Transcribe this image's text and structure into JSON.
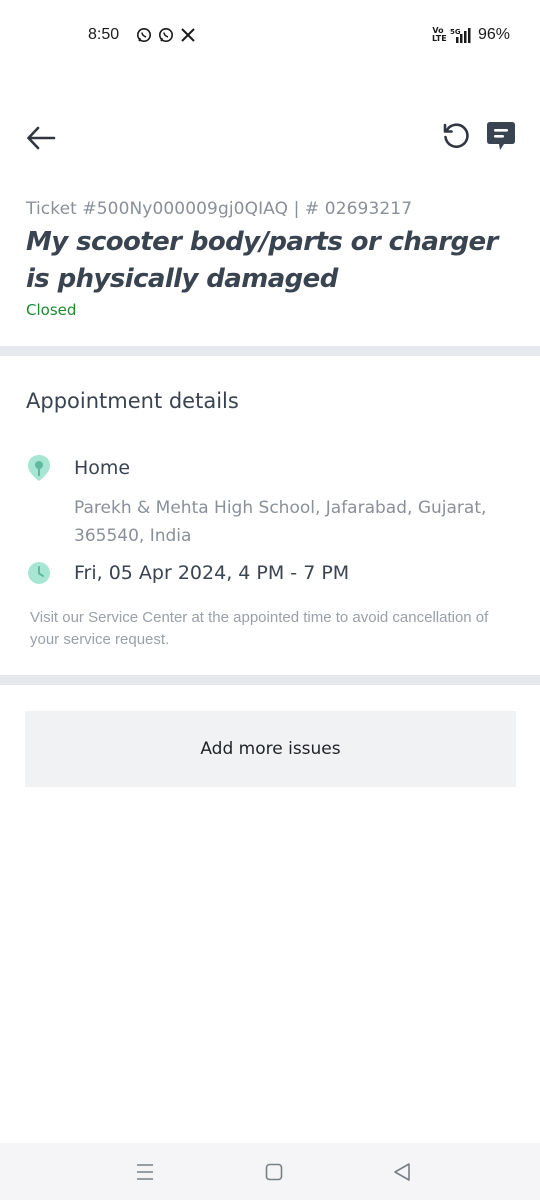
{
  "status_bar": {
    "time": "8:50",
    "notification_icons": [
      "whatsapp-icon",
      "whatsapp-icon",
      "x-icon"
    ],
    "network_label": "Vo LTE",
    "network_type": "5G",
    "battery": "96%"
  },
  "app_bar": {
    "back_icon": "arrow-left-icon",
    "refresh_icon": "history-icon",
    "chat_icon": "chat-bubble-icon"
  },
  "ticket": {
    "id_line": "Ticket #500Ny000009gj0QIAQ | # 02693217",
    "title": "My scooter body/parts or charger is physically damaged",
    "status": "Closed",
    "status_color": "#1e8a2e"
  },
  "appointment": {
    "section_title": "Appointment details",
    "location_label": "Home",
    "address": "Parekh & Mehta High School, Jafarabad, Gujarat, 365540, India",
    "datetime": "Fri, 05 Apr 2024, 4 PM - 7 PM",
    "note": "Visit our Service Center at the appointed time to avoid cancellation of your service request."
  },
  "actions": {
    "add_issues_label": "Add more issues"
  },
  "colors": {
    "accent_icon": "#9fe3cf",
    "divider": "#e6eaef",
    "button_bg": "#f1f2f4"
  }
}
